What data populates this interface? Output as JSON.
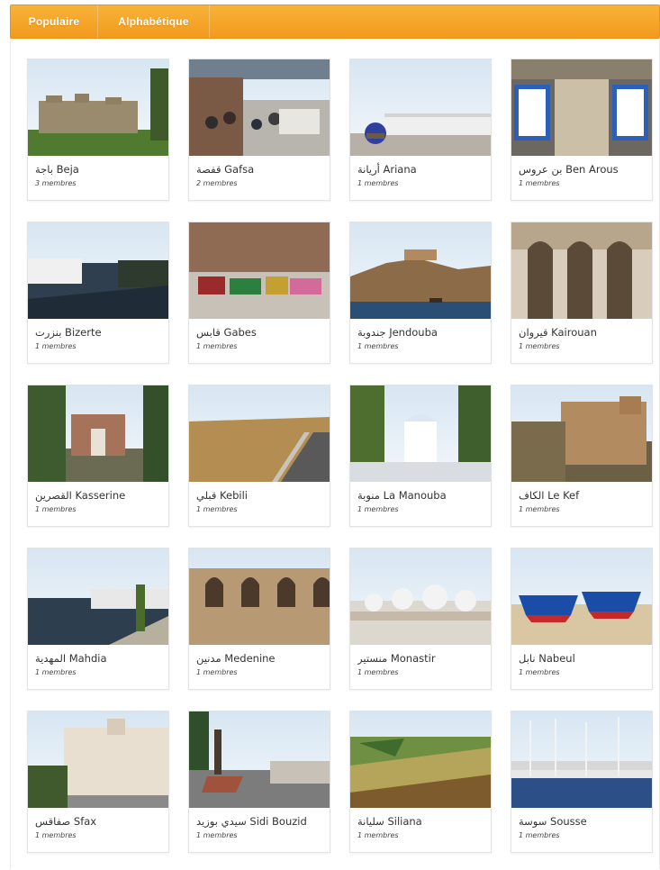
{
  "tabs": [
    {
      "label": "Populaire"
    },
    {
      "label": "Alphabétique"
    }
  ],
  "members_suffix": "membres",
  "colors": {
    "accent": "#f4a52a"
  },
  "regions": [
    {
      "name": "Beja باجة",
      "name_display": "باجة Beja",
      "count": "3",
      "members": "3 membres",
      "scene": "fortress"
    },
    {
      "name": "Gafsa قفصة",
      "name_display": "قفصة Gafsa",
      "count": "2",
      "members": "2 membres",
      "scene": "market-street"
    },
    {
      "name": "Ariana أريانة",
      "name_display": "أريانة Ariana",
      "count": "1",
      "members": "1 membres",
      "scene": "dome-building"
    },
    {
      "name": "Ben Arous بن عروس",
      "name_display": "بن عروس Ben Arous",
      "count": "1",
      "members": "1 membres",
      "scene": "tiled-windows"
    },
    {
      "name": "Bizerte بنزرت",
      "name_display": "بنزرت Bizerte",
      "count": "1",
      "members": "1 membres",
      "scene": "canal"
    },
    {
      "name": "Gabes قابس",
      "name_display": "قابس Gabes",
      "count": "1",
      "members": "1 membres",
      "scene": "souk"
    },
    {
      "name": "Jendouba جندوبة",
      "name_display": "جندوبة Jendouba",
      "count": "1",
      "members": "1 membres",
      "scene": "coastal-fort"
    },
    {
      "name": "Kairouan قيروان",
      "name_display": "قيروان Kairouan",
      "count": "1",
      "members": "1 membres",
      "scene": "arches"
    },
    {
      "name": "Kasserine القصرين",
      "name_display": "القصرين Kasserine",
      "count": "1",
      "members": "1 membres",
      "scene": "roman-arch"
    },
    {
      "name": "Kebili قبلي",
      "name_display": "قبلي Kebili",
      "count": "1",
      "members": "1 membres",
      "scene": "desert-road"
    },
    {
      "name": "La Manouba منوبة",
      "name_display": "منوبة La Manouba",
      "count": "1",
      "members": "1 membres",
      "scene": "white-gate"
    },
    {
      "name": "Le Kef الكاف",
      "name_display": "الكاف Le Kef",
      "count": "1",
      "members": "1 membres",
      "scene": "kasbah"
    },
    {
      "name": "Mahdia المهدية",
      "name_display": "المهدية Mahdia",
      "count": "1",
      "members": "1 membres",
      "scene": "seaside"
    },
    {
      "name": "Medenine مدنين",
      "name_display": "مدنين Medenine",
      "count": "1",
      "members": "1 membres",
      "scene": "ksour"
    },
    {
      "name": "Monastir منستير",
      "name_display": "منستير Monastir",
      "count": "1",
      "members": "1 membres",
      "scene": "mosque-domes"
    },
    {
      "name": "Nabeul نابل",
      "name_display": "نابل Nabeul",
      "count": "1",
      "members": "1 membres",
      "scene": "boats"
    },
    {
      "name": "Sfax صفاقس",
      "name_display": "صفاقس Sfax",
      "count": "1",
      "members": "1 membres",
      "scene": "colonial-building"
    },
    {
      "name": "Sidi Bouzid سيدي بوزيد",
      "name_display": "سيدي بوزيد Sidi Bouzid",
      "count": "1",
      "members": "1 membres",
      "scene": "monument-street"
    },
    {
      "name": "Siliana سليانة",
      "name_display": "سليانة Siliana",
      "count": "1",
      "members": "1 membres",
      "scene": "aerial-fields"
    },
    {
      "name": "Sousse سوسة",
      "name_display": "سوسة Sousse",
      "count": "1",
      "members": "1 membres",
      "scene": "marina"
    }
  ]
}
